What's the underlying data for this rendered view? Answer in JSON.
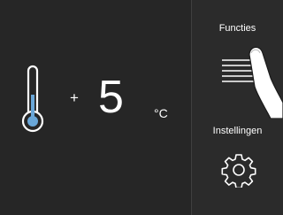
{
  "temperature": {
    "sign": "+",
    "value": "5",
    "unit": "°C"
  },
  "menu": {
    "functions_label": "Functies",
    "settings_label": "Instellingen"
  },
  "icons": {
    "thermometer": "thermometer-icon",
    "functions": "list-lines-icon",
    "settings": "gear-icon",
    "pointer": "finger-pointer-icon"
  },
  "colors": {
    "background": "#262626",
    "panel": "#2b2b2b",
    "foreground": "#ffffff",
    "thermometer_accent": "#6aa7d8"
  }
}
